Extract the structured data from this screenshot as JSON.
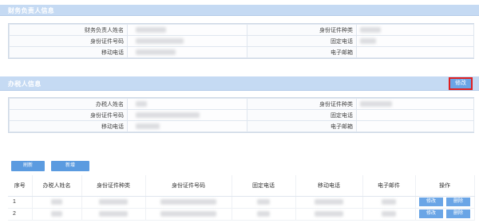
{
  "finance_section": {
    "title": "财务负责人信息",
    "labels": {
      "name": "财务负责人姓名",
      "id_type": "身份证件种类",
      "id_number": "身份证件号码",
      "phone": "固定电话",
      "mobile": "移动电话",
      "email": "电子邮箱"
    }
  },
  "tax_section": {
    "title": "办税人信息",
    "edit_label": "修改",
    "labels": {
      "name": "办税人姓名",
      "id_type": "身份证件种类",
      "id_number": "身份证件号码",
      "phone": "固定电话",
      "mobile": "移动电话",
      "email": "电子邮箱"
    }
  },
  "toolbar": {
    "refresh_label": "刷新",
    "add_label": "新增"
  },
  "list": {
    "columns": [
      "序号",
      "办税人姓名",
      "身份证件种类",
      "身份证件号码",
      "固定电话",
      "移动电话",
      "电子邮件",
      "操作"
    ],
    "rows": [
      {
        "seq": "1",
        "edit": "修改",
        "delete": "删除"
      },
      {
        "seq": "2",
        "edit": "修改",
        "delete": "删除"
      }
    ]
  },
  "colors": {
    "header_bg": "#c5daf3",
    "button_bg": "#5b9be0",
    "highlight": "#e02020"
  }
}
